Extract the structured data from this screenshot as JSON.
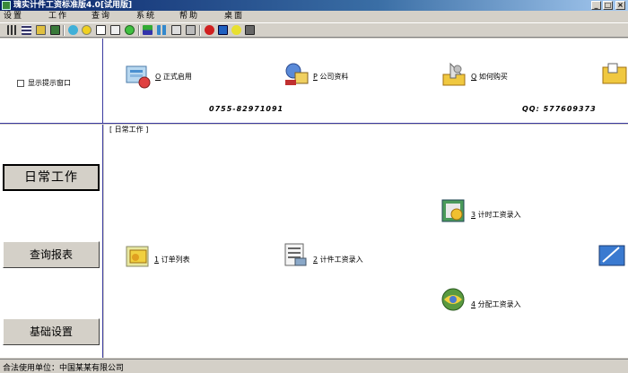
{
  "window": {
    "title": "瑰实计件工资标准版4.0[试用版]",
    "controls": {
      "minimize": "_",
      "maximize": "□",
      "close": "×"
    }
  },
  "menu": [
    "设置",
    "工作",
    "查询",
    "系统",
    "帮助",
    "桌面"
  ],
  "toolbar_icons": [
    "grid-icon",
    "table-icon",
    "windows-icon",
    "printer-icon",
    "globe-icon",
    "smile-icon",
    "document-icon",
    "report-icon",
    "face-icon",
    "bars-icon",
    "tiles-icon",
    "preview-icon",
    "export-icon",
    "stop-icon",
    "mail-icon",
    "help-icon",
    "exit-icon"
  ],
  "top": {
    "checkbox_label": "显示提示窗口",
    "shortcuts": [
      {
        "key": "O",
        "label": "正式启用"
      },
      {
        "key": "P",
        "label": "公司资料"
      },
      {
        "key": "Q",
        "label": "如何购买"
      }
    ],
    "phone": "0755-82971091",
    "qq": "QQ: 577609373"
  },
  "sidebar": {
    "buttons": [
      "日常工作",
      "查询报表",
      "基础设置"
    ]
  },
  "main": {
    "section_title": "[ 日常工作 ]",
    "items": [
      {
        "key": "1",
        "label": "订单列表"
      },
      {
        "key": "2",
        "label": "计件工资录入"
      },
      {
        "key": "3",
        "label": "计时工资录入"
      },
      {
        "key": "4",
        "label": "分配工资录入"
      }
    ]
  },
  "status": {
    "text": "合法使用单位：中国某某有限公司"
  }
}
